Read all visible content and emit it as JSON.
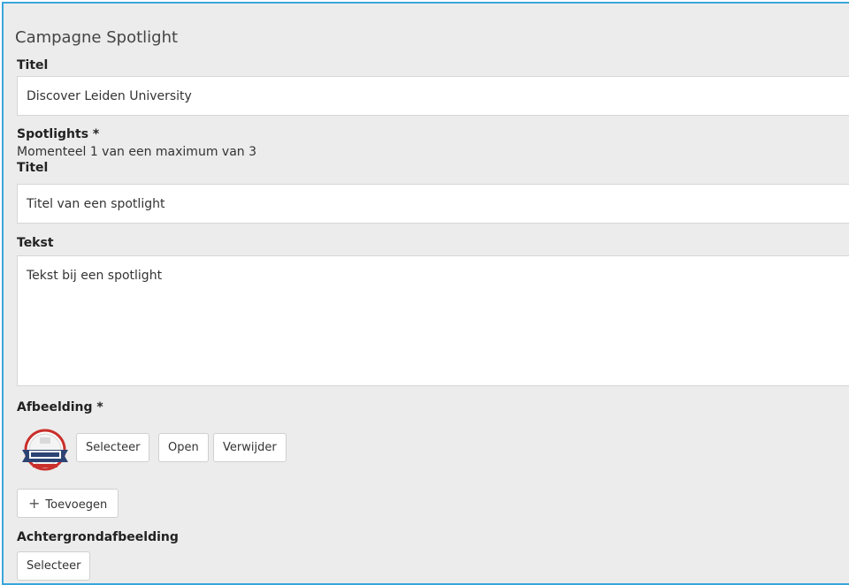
{
  "section": {
    "title": "Campagne Spotlight"
  },
  "titel": {
    "label": "Titel",
    "value": "Discover Leiden University"
  },
  "spotlights": {
    "label": "Spotlights *",
    "count_text": "Momenteel 1 van een maximum van 3",
    "titel_label": "Titel",
    "titel_value": "Titel van een spotlight",
    "tekst_label": "Tekst",
    "tekst_value": "Tekst bij een spotlight",
    "afbeelding_label": "Afbeelding *",
    "buttons": {
      "select": "Selecteer",
      "open": "Open",
      "remove": "Verwijder"
    },
    "add_button": "Toevoegen",
    "add_icon": "plus-icon"
  },
  "achtergrond": {
    "label": "Achtergrondafbeelding",
    "select": "Selecteer"
  },
  "colors": {
    "frame_border": "#3aa6dc",
    "panel_bg": "#ececec"
  }
}
